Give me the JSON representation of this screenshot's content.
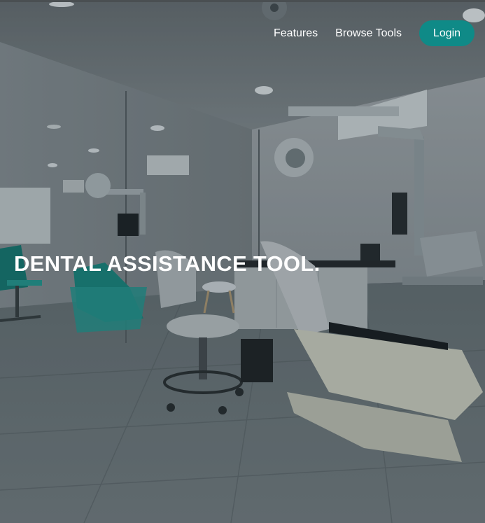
{
  "nav": {
    "links": [
      {
        "label": "Features"
      },
      {
        "label": "Browse Tools"
      }
    ],
    "login_label": "Login"
  },
  "hero": {
    "title": "DENTAL ASSISTANCE TOOL.",
    "background": "dental-clinic-photo"
  },
  "colors": {
    "accent": "#0f8a87",
    "text": "#ffffff"
  }
}
